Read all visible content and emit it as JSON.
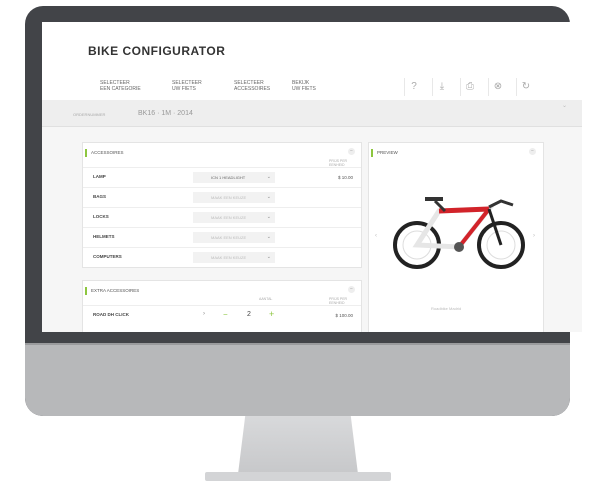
{
  "app": {
    "title": "BIKE CONFIGURATOR"
  },
  "tabs": [
    {
      "line1": "SELECTEER",
      "line2": "EEN CATEGORIE"
    },
    {
      "line1": "SELECTEER",
      "line2": "UW FIETS"
    },
    {
      "line1": "SELECTEER",
      "line2": "ACCESSOIRES"
    },
    {
      "line1": "BEKIJK",
      "line2": "UW FIETS"
    }
  ],
  "toolbar_icons": [
    "help-icon",
    "download-icon",
    "print-icon",
    "close-icon",
    "refresh-icon"
  ],
  "toolbar_glyphs": [
    "?",
    "⤓",
    "⎙",
    "⊗",
    "↻"
  ],
  "order": {
    "label": "ORDERNUMMER",
    "number": "BK16 · 1M · 2014"
  },
  "accessories": {
    "title": "ACCESSOIRES",
    "price_header": "PRIJS PER EENHEID",
    "rows": [
      {
        "label": "LAMP",
        "select": "ICN 1 HEADLIGHT",
        "price": "$ 10.00"
      },
      {
        "label": "BAGS",
        "select": "MAAK EEN KEUZE",
        "price": ""
      },
      {
        "label": "LOCKS",
        "select": "MAAK EEN KEUZE",
        "price": ""
      },
      {
        "label": "HELMETS",
        "select": "MAAK EEN KEUZE",
        "price": ""
      },
      {
        "label": "COMPUTERS",
        "select": "MAAK EEN KEUZE",
        "price": ""
      }
    ]
  },
  "preview": {
    "title": "PREVIEW",
    "caption": "Roadbike Madrid"
  },
  "extra": {
    "title": "EXTRA ACCESSOIRES",
    "qty_header": "AANTAL",
    "price_header": "PRIJS PER EENHEID",
    "rows": [
      {
        "label": "ROAD DH CLICK",
        "qty": "2",
        "price": "$ 100.00"
      }
    ]
  },
  "colors": {
    "accent": "#8dc63f",
    "bike_red": "#d2232a"
  }
}
